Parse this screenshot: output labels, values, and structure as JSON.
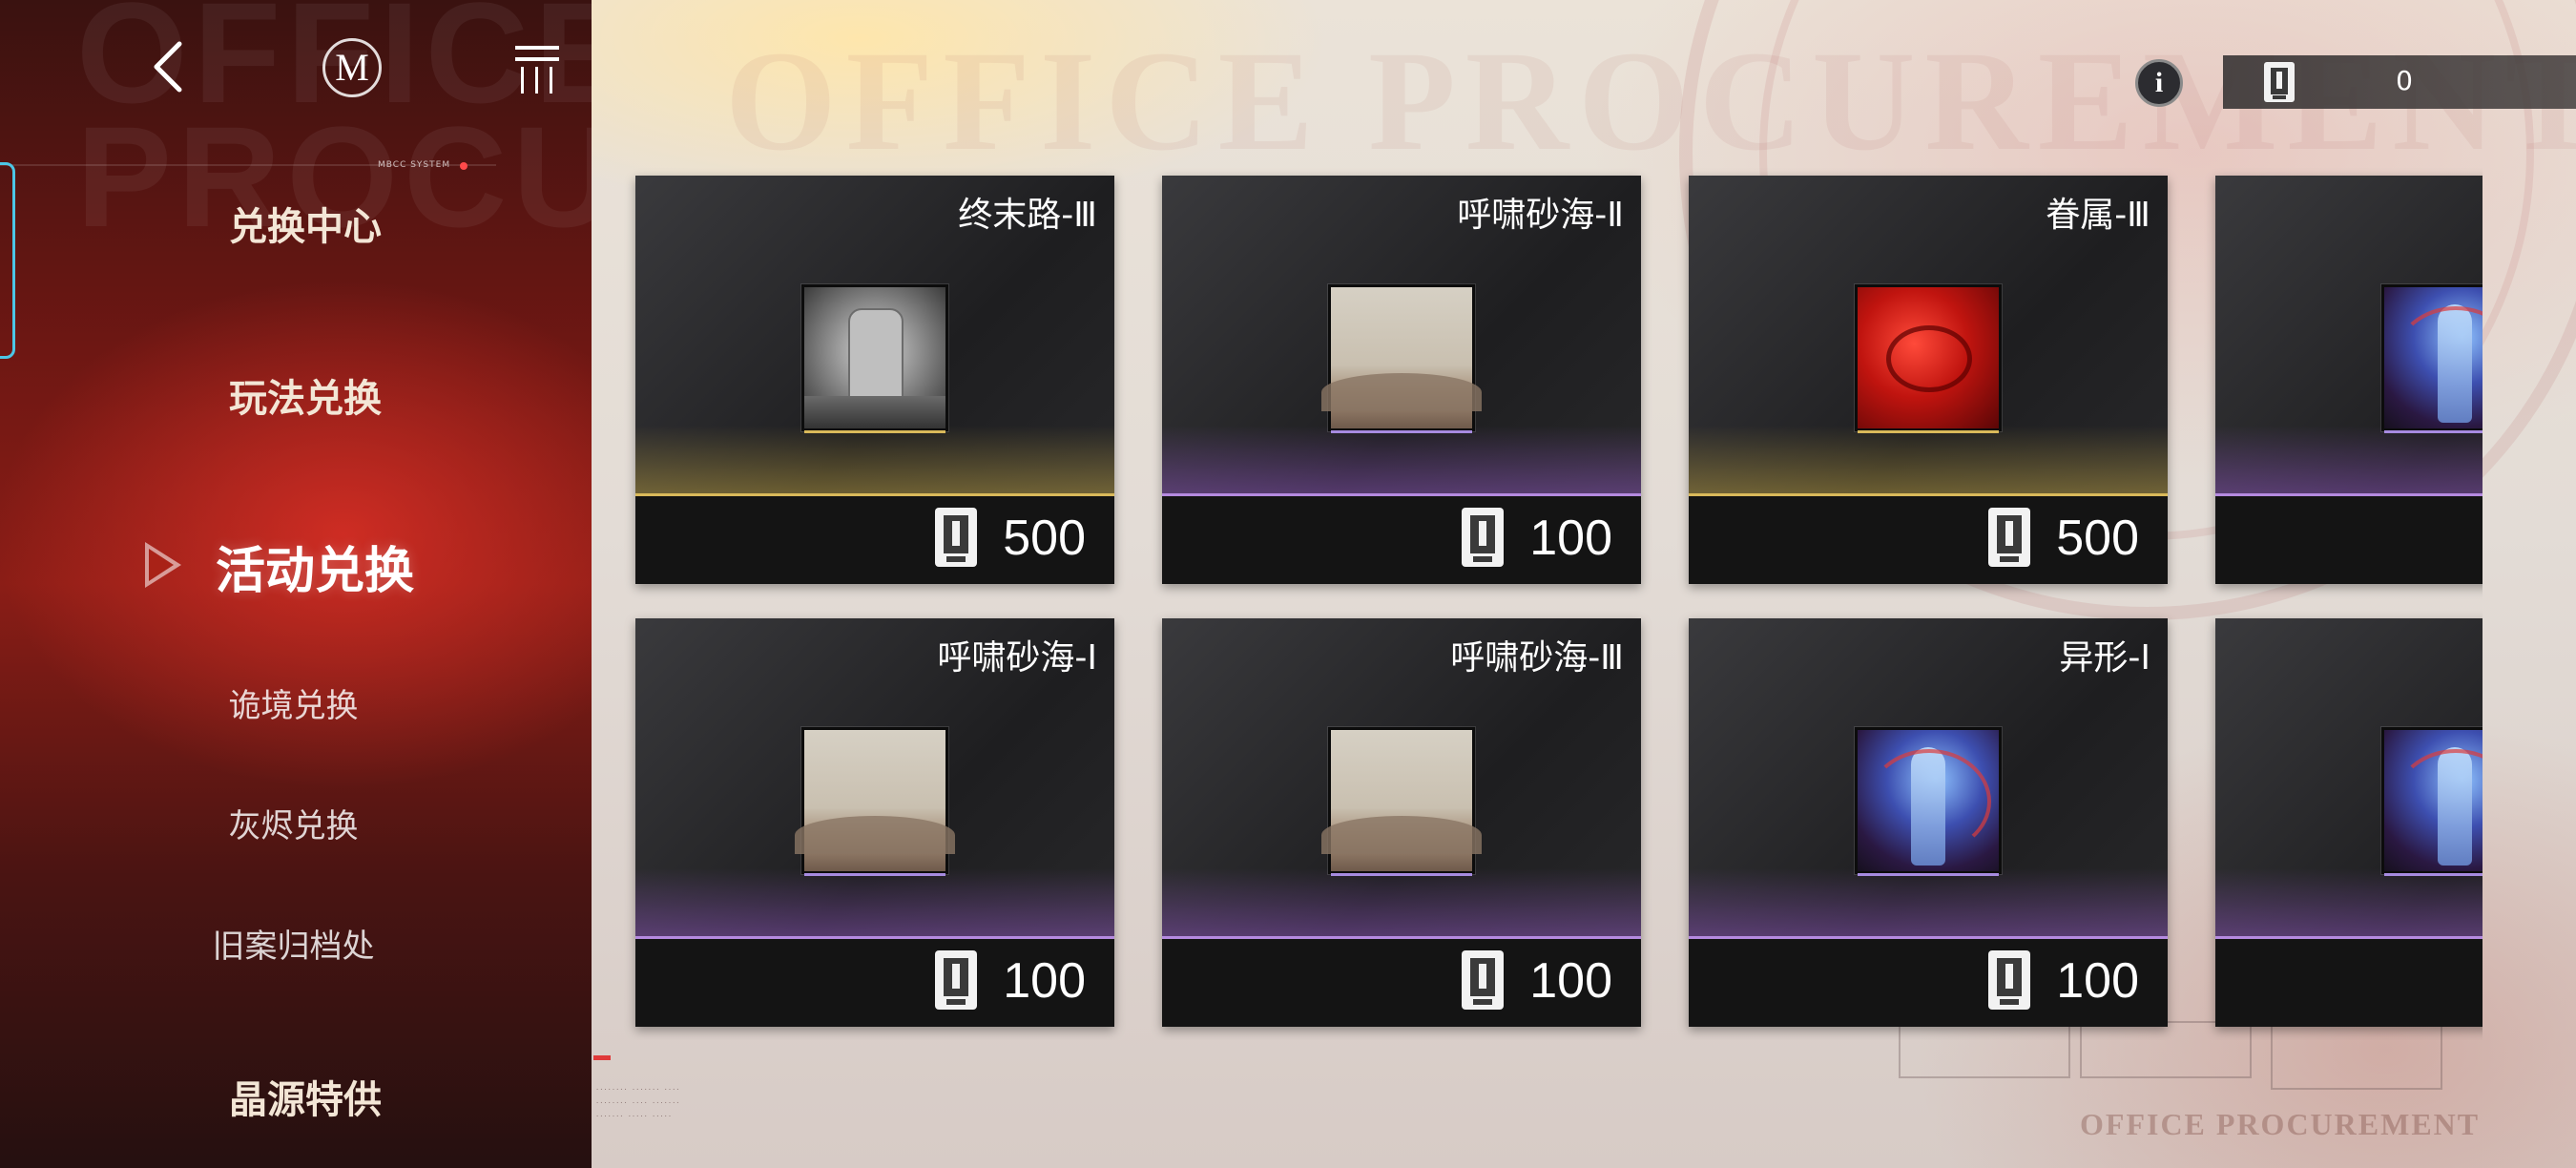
{
  "background": {
    "watermark": "OFFICE PROCUREMENT",
    "side_watermark": "OFFICE PROCUREMENT",
    "system_label": "MBCC SYSTEM"
  },
  "top_nav": {
    "home_letter": "M"
  },
  "sidebar": {
    "items": [
      {
        "label": "兑换中心",
        "style": "main"
      },
      {
        "label": "玩法兑换",
        "style": "main"
      },
      {
        "label": "活动兑换",
        "style": "active"
      },
      {
        "label": "诡境兑换",
        "style": "sub"
      },
      {
        "label": "灰烬兑换",
        "style": "sub"
      },
      {
        "label": "旧案归档处",
        "style": "sub"
      },
      {
        "label": "晶源特供",
        "style": "main"
      }
    ]
  },
  "currency": {
    "info_symbol": "i",
    "value": "0"
  },
  "cards": [
    {
      "title": "终末路-Ⅲ",
      "price": "500",
      "rarity": "gold",
      "art": "tomb"
    },
    {
      "title": "呼啸砂海-Ⅱ",
      "price": "100",
      "rarity": "purple",
      "art": "sand"
    },
    {
      "title": "眷属-Ⅲ",
      "price": "500",
      "rarity": "gold",
      "art": "blood"
    },
    {
      "title": "",
      "price": "",
      "rarity": "purple",
      "art": "alien"
    },
    {
      "title": "呼啸砂海-Ⅰ",
      "price": "100",
      "rarity": "purple",
      "art": "sand"
    },
    {
      "title": "呼啸砂海-Ⅲ",
      "price": "100",
      "rarity": "purple",
      "art": "sand"
    },
    {
      "title": "异形-Ⅰ",
      "price": "100",
      "rarity": "purple",
      "art": "alien"
    },
    {
      "title": "",
      "price": "",
      "rarity": "purple",
      "art": "alien"
    }
  ],
  "colors": {
    "gold_rarity": "#d9b95a",
    "purple_rarity": "#a78be0",
    "sidebar_red": "#8b1d16",
    "accent_cyan": "#4cc6e6"
  }
}
